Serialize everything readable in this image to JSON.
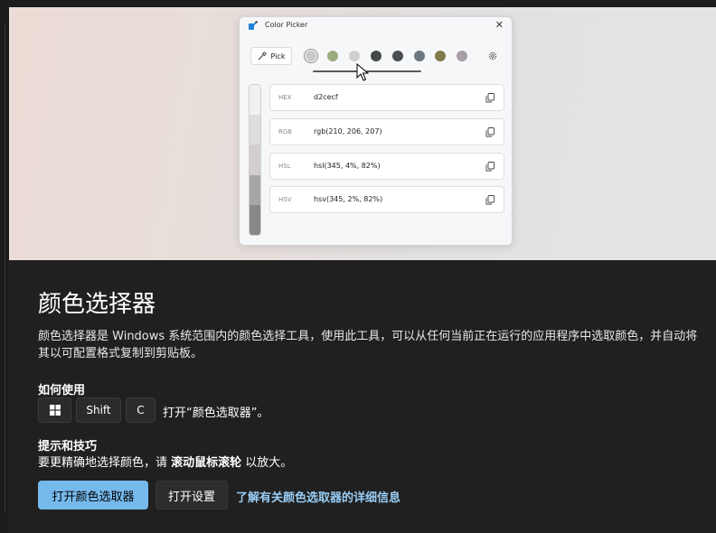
{
  "picker": {
    "title": "Color Picker",
    "close": "✕",
    "pick_label": "Pick",
    "swatches": [
      "#c9c9c9",
      "#9aab7e",
      "#d2cecf",
      "#45494a",
      "#4a4d52",
      "#6b7884",
      "#7e7a4c",
      "#a79ea6"
    ],
    "selected_swatch_index": 0,
    "shades": [
      "#f2f0f1",
      "#dedcdd",
      "#d2cecf",
      "#a9a6a7",
      "#8a8788"
    ],
    "rows": [
      {
        "format": "HEX",
        "value": "d2cecf"
      },
      {
        "format": "RGB",
        "value": "rgb(210, 206, 207)"
      },
      {
        "format": "HSL",
        "value": "hsl(345, 4%, 82%)"
      },
      {
        "format": "HSV",
        "value": "hsv(345, 2%, 82%)"
      }
    ]
  },
  "page": {
    "title": "颜色选择器",
    "description": "颜色选择器是 Windows 系统范围内的颜色选择工具，使用此工具，可以从任何当前正在运行的应用程序中选取颜色，并自动将其以可配置格式复制到剪贴板。",
    "how_to_heading": "如何使用",
    "keys": [
      "Win",
      "Shift",
      "C"
    ],
    "shortcut_text": "打开“颜色选取器”。",
    "tips_heading": "提示和技巧",
    "tip_prefix": "要更精确地选择颜色，请 ",
    "tip_bold": "滚动鼠标滚轮",
    "tip_suffix": " 以放大。",
    "open_button": "打开颜色选取器",
    "settings_button": "打开设置",
    "learn_more": "了解有关颜色选取器的详细信息"
  },
  "colors": {
    "accent": "#76b9ed",
    "link": "#99cdf5",
    "background": "#202020"
  }
}
